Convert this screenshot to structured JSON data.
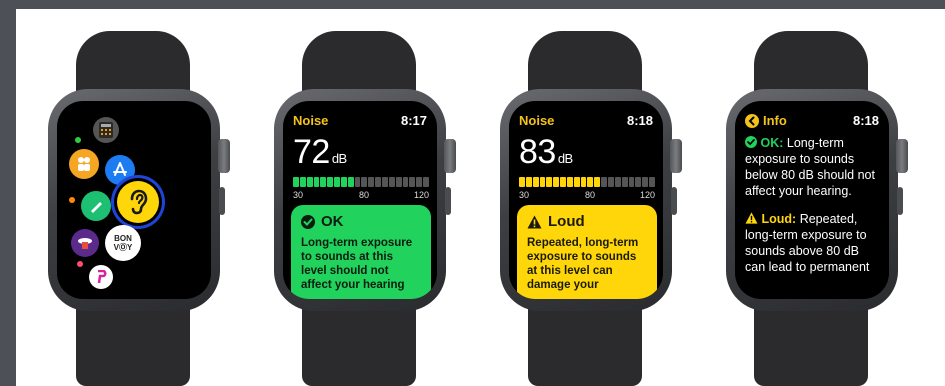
{
  "watch1": {
    "apps": [
      "calculator",
      "find-people",
      "app-store",
      "ear-noise",
      "pen",
      "cinema",
      "bonvoy",
      "paypal"
    ],
    "bonvoy_line1": "BON",
    "bonvoy_line2": "VⓄY"
  },
  "watch2": {
    "app_title": "Noise",
    "time": "8:17",
    "level": "72",
    "unit": "dB",
    "scale": [
      "30",
      "80",
      "120"
    ],
    "card_title": "OK",
    "card_body": "Long-term exposure to sounds at this level should not affect your hearing"
  },
  "watch3": {
    "app_title": "Noise",
    "time": "8:18",
    "level": "83",
    "unit": "dB",
    "scale": [
      "30",
      "80",
      "120"
    ],
    "card_title": "Loud",
    "card_body": "Repeated, long-term exposure to sounds at this level can damage your"
  },
  "watch4": {
    "back_label": "Info",
    "time": "8:18",
    "ok_label": "OK:",
    "ok_text": "Long-term exposure to sounds below 80 dB should not affect your hearing.",
    "loud_label": "Loud:",
    "loud_text": "Repeated, long-term exposure to sounds above 80 dB can lead to permanent"
  },
  "colors": {
    "ok": "#21d25c",
    "loud": "#ffd60a",
    "noise_title": "#f3c31a",
    "meter_off": "#555555"
  }
}
